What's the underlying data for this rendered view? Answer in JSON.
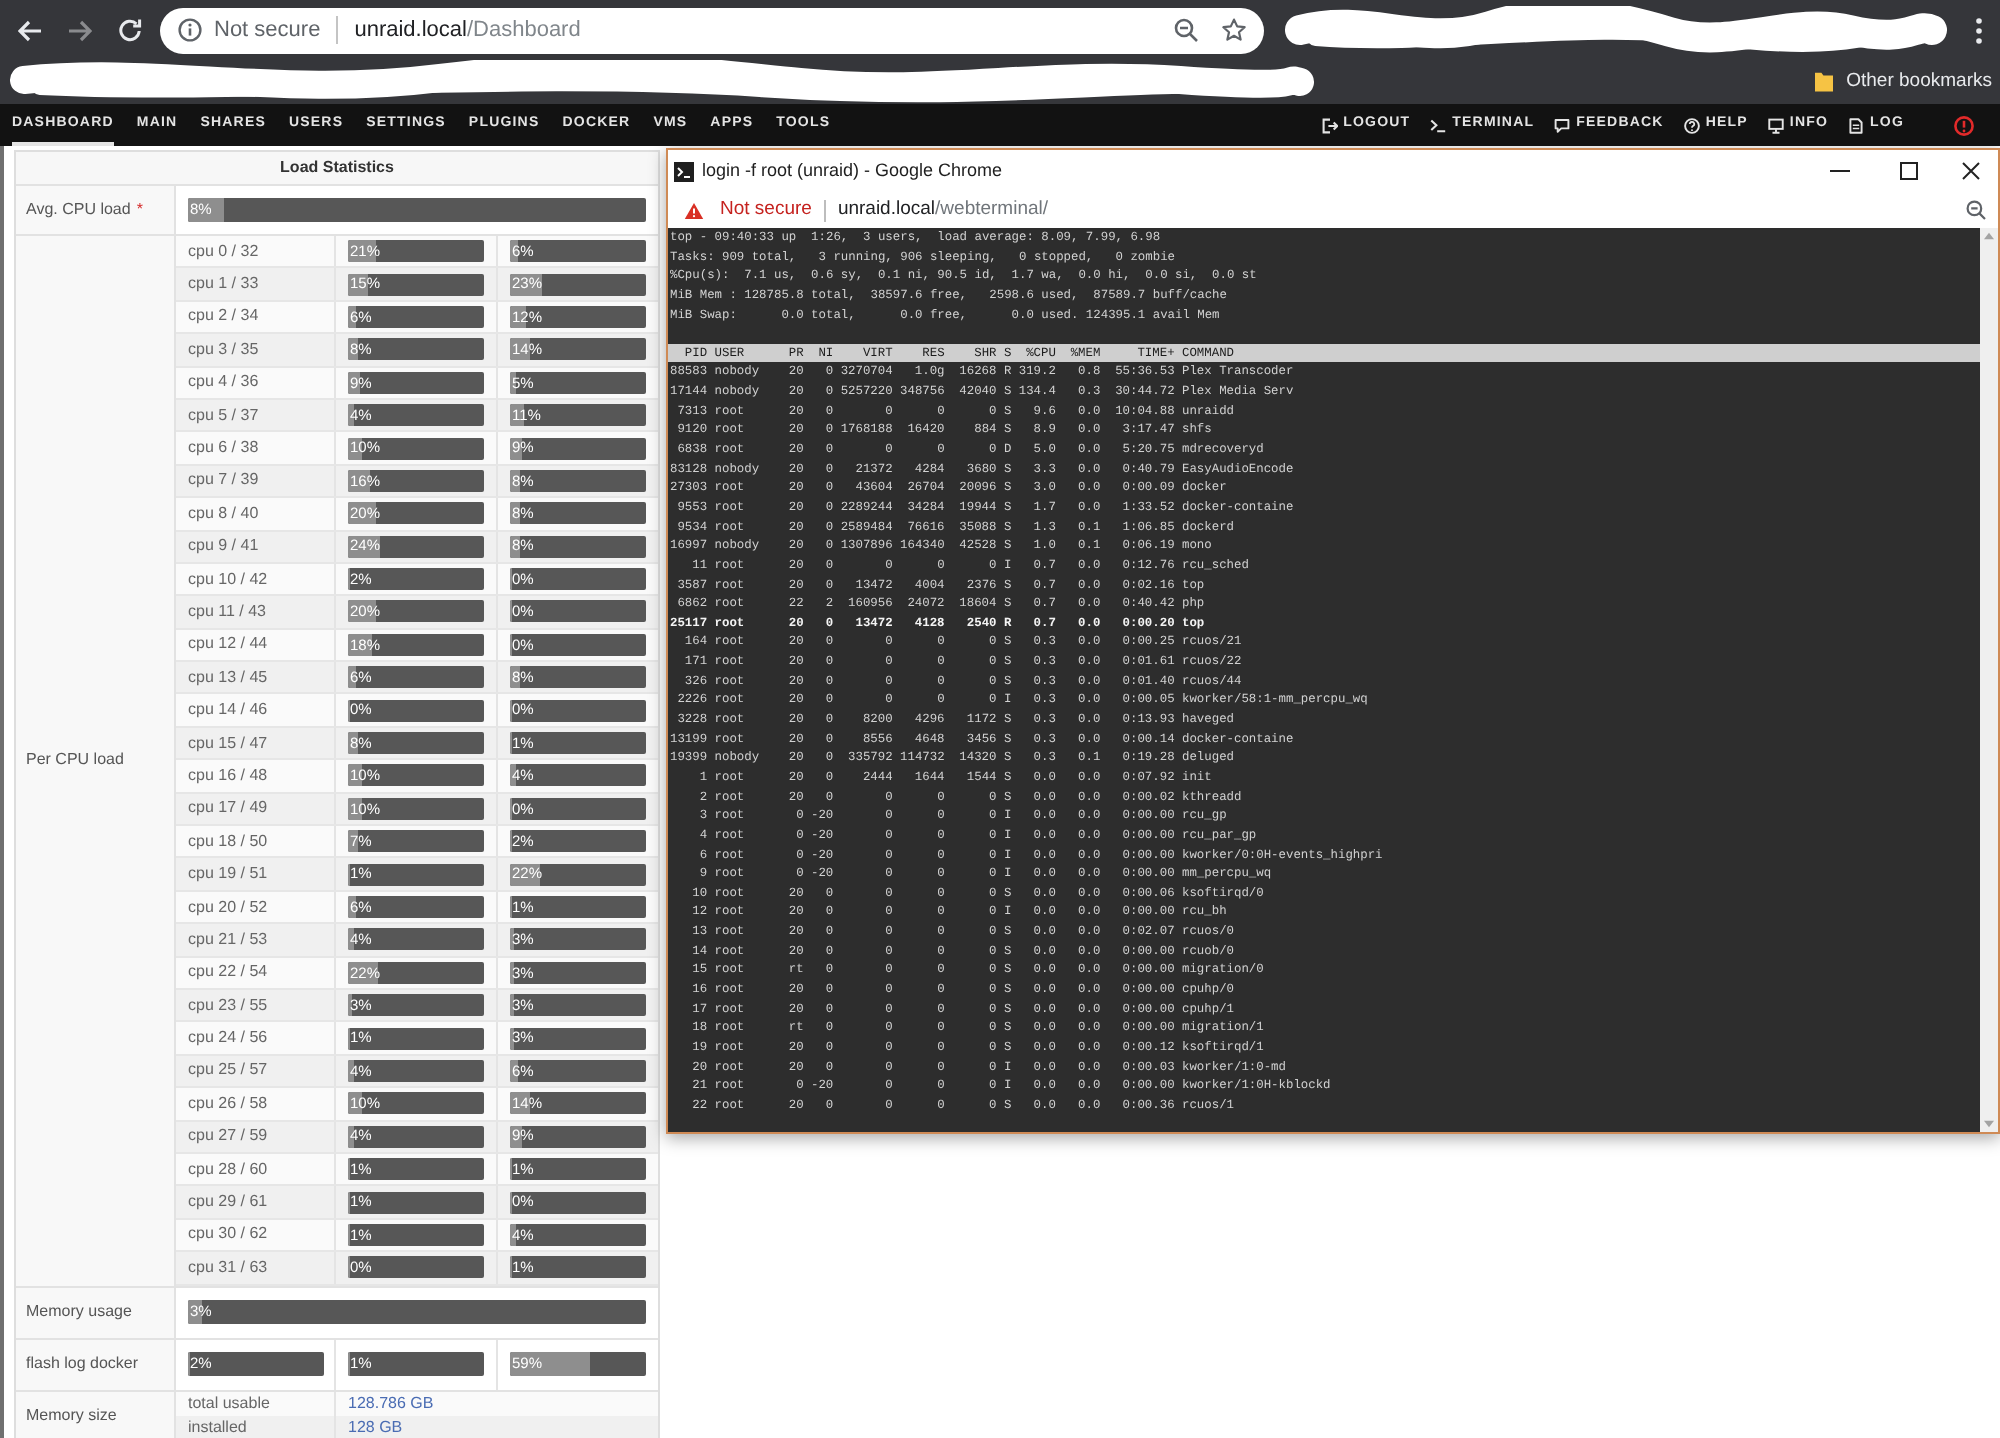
{
  "browser": {
    "address_bar": {
      "security": "Not secure",
      "host": "unraid.local",
      "path": "/Dashboard"
    },
    "bookmarks_bar": {
      "items": [
        {
          "label": "Other bookmarks"
        }
      ]
    }
  },
  "nav": {
    "items": [
      {
        "label": "DASHBOARD",
        "selected": true
      },
      {
        "label": "MAIN",
        "selected": false
      },
      {
        "label": "SHARES",
        "selected": false
      },
      {
        "label": "USERS",
        "selected": false
      },
      {
        "label": "SETTINGS",
        "selected": false
      },
      {
        "label": "PLUGINS",
        "selected": false
      },
      {
        "label": "DOCKER",
        "selected": false
      },
      {
        "label": "VMS",
        "selected": false
      },
      {
        "label": "APPS",
        "selected": false
      },
      {
        "label": "TOOLS",
        "selected": false
      }
    ],
    "actions": [
      {
        "label": "LOGOUT"
      },
      {
        "label": "TERMINAL"
      },
      {
        "label": "FEEDBACK"
      },
      {
        "label": "HELP"
      },
      {
        "label": "INFO"
      },
      {
        "label": "LOG"
      }
    ]
  },
  "load_statistics": {
    "title": "Load Statistics",
    "avg_cpu_load": {
      "label": "Avg. CPU load",
      "marker": "*",
      "reading": "8%",
      "level": 0.08
    },
    "per_cpu_load": {
      "label": "Per CPU load",
      "rows": [
        {
          "name": "cpu 0 / 32",
          "cores": [
            {
              "reading": "21%",
              "level": 0.21
            },
            {
              "reading": "6%",
              "level": 0.06
            }
          ]
        },
        {
          "name": "cpu 1 / 33",
          "cores": [
            {
              "reading": "15%",
              "level": 0.15
            },
            {
              "reading": "23%",
              "level": 0.23
            }
          ]
        },
        {
          "name": "cpu 2 / 34",
          "cores": [
            {
              "reading": "6%",
              "level": 0.06
            },
            {
              "reading": "12%",
              "level": 0.12
            }
          ]
        },
        {
          "name": "cpu 3 / 35",
          "cores": [
            {
              "reading": "8%",
              "level": 0.08
            },
            {
              "reading": "14%",
              "level": 0.14
            }
          ]
        },
        {
          "name": "cpu 4 / 36",
          "cores": [
            {
              "reading": "9%",
              "level": 0.09
            },
            {
              "reading": "5%",
              "level": 0.05
            }
          ]
        },
        {
          "name": "cpu 5 / 37",
          "cores": [
            {
              "reading": "4%",
              "level": 0.04
            },
            {
              "reading": "11%",
              "level": 0.11
            }
          ]
        },
        {
          "name": "cpu 6 / 38",
          "cores": [
            {
              "reading": "10%",
              "level": 0.1
            },
            {
              "reading": "9%",
              "level": 0.09
            }
          ]
        },
        {
          "name": "cpu 7 / 39",
          "cores": [
            {
              "reading": "16%",
              "level": 0.16
            },
            {
              "reading": "8%",
              "level": 0.08
            }
          ]
        },
        {
          "name": "cpu 8 / 40",
          "cores": [
            {
              "reading": "20%",
              "level": 0.2
            },
            {
              "reading": "8%",
              "level": 0.08
            }
          ]
        },
        {
          "name": "cpu 9 / 41",
          "cores": [
            {
              "reading": "24%",
              "level": 0.24
            },
            {
              "reading": "8%",
              "level": 0.08
            }
          ]
        },
        {
          "name": "cpu 10 / 42",
          "cores": [
            {
              "reading": "2%",
              "level": 0.02
            },
            {
              "reading": "0%",
              "level": 0
            }
          ]
        },
        {
          "name": "cpu 11 / 43",
          "cores": [
            {
              "reading": "20%",
              "level": 0.2
            },
            {
              "reading": "0%",
              "level": 0
            }
          ]
        },
        {
          "name": "cpu 12 / 44",
          "cores": [
            {
              "reading": "18%",
              "level": 0.18
            },
            {
              "reading": "0%",
              "level": 0
            }
          ]
        },
        {
          "name": "cpu 13 / 45",
          "cores": [
            {
              "reading": "6%",
              "level": 0.06
            },
            {
              "reading": "8%",
              "level": 0.08
            }
          ]
        },
        {
          "name": "cpu 14 / 46",
          "cores": [
            {
              "reading": "0%",
              "level": 0
            },
            {
              "reading": "0%",
              "level": 0
            }
          ]
        },
        {
          "name": "cpu 15 / 47",
          "cores": [
            {
              "reading": "8%",
              "level": 0.08
            },
            {
              "reading": "1%",
              "level": 0.01
            }
          ]
        },
        {
          "name": "cpu 16 / 48",
          "cores": [
            {
              "reading": "10%",
              "level": 0.1
            },
            {
              "reading": "4%",
              "level": 0.04
            }
          ]
        },
        {
          "name": "cpu 17 / 49",
          "cores": [
            {
              "reading": "10%",
              "level": 0.1
            },
            {
              "reading": "0%",
              "level": 0
            }
          ]
        },
        {
          "name": "cpu 18 / 50",
          "cores": [
            {
              "reading": "7%",
              "level": 0.07
            },
            {
              "reading": "2%",
              "level": 0.02
            }
          ]
        },
        {
          "name": "cpu 19 / 51",
          "cores": [
            {
              "reading": "1%",
              "level": 0.01
            },
            {
              "reading": "22%",
              "level": 0.22
            }
          ]
        },
        {
          "name": "cpu 20 / 52",
          "cores": [
            {
              "reading": "6%",
              "level": 0.06
            },
            {
              "reading": "1%",
              "level": 0.01
            }
          ]
        },
        {
          "name": "cpu 21 / 53",
          "cores": [
            {
              "reading": "4%",
              "level": 0.04
            },
            {
              "reading": "3%",
              "level": 0.03
            }
          ]
        },
        {
          "name": "cpu 22 / 54",
          "cores": [
            {
              "reading": "22%",
              "level": 0.22
            },
            {
              "reading": "3%",
              "level": 0.03
            }
          ]
        },
        {
          "name": "cpu 23 / 55",
          "cores": [
            {
              "reading": "3%",
              "level": 0.03
            },
            {
              "reading": "3%",
              "level": 0.03
            }
          ]
        },
        {
          "name": "cpu 24 / 56",
          "cores": [
            {
              "reading": "1%",
              "level": 0.01
            },
            {
              "reading": "3%",
              "level": 0.03
            }
          ]
        },
        {
          "name": "cpu 25 / 57",
          "cores": [
            {
              "reading": "4%",
              "level": 0.04
            },
            {
              "reading": "6%",
              "level": 0.06
            }
          ]
        },
        {
          "name": "cpu 26 / 58",
          "cores": [
            {
              "reading": "10%",
              "level": 0.1
            },
            {
              "reading": "14%",
              "level": 0.14
            }
          ]
        },
        {
          "name": "cpu 27 / 59",
          "cores": [
            {
              "reading": "4%",
              "level": 0.04
            },
            {
              "reading": "9%",
              "level": 0.09
            }
          ]
        },
        {
          "name": "cpu 28 / 60",
          "cores": [
            {
              "reading": "1%",
              "level": 0.01
            },
            {
              "reading": "1%",
              "level": 0.01
            }
          ]
        },
        {
          "name": "cpu 29 / 61",
          "cores": [
            {
              "reading": "1%",
              "level": 0.01
            },
            {
              "reading": "0%",
              "level": 0
            }
          ]
        },
        {
          "name": "cpu 30 / 62",
          "cores": [
            {
              "reading": "1%",
              "level": 0.01
            },
            {
              "reading": "4%",
              "level": 0.04
            }
          ]
        },
        {
          "name": "cpu 31 / 63",
          "cores": [
            {
              "reading": "0%",
              "level": 0
            },
            {
              "reading": "1%",
              "level": 0.01
            }
          ]
        }
      ]
    },
    "memory_usage": {
      "label": "Memory usage",
      "reading": "3%",
      "level": 0.03
    },
    "flash_log_docker": {
      "label": "flash log docker",
      "meters": [
        {
          "reading": "2%",
          "level": 0.02
        },
        {
          "reading": "1%",
          "level": 0.01
        },
        {
          "reading": "59%",
          "level": 0.59
        }
      ]
    },
    "memory_size": {
      "label": "Memory size",
      "rows": [
        {
          "label": "total usable",
          "value": "128.786 GB"
        },
        {
          "label": "installed",
          "value": "128 GB"
        }
      ]
    }
  },
  "terminal_window": {
    "title": "login -f root (unraid) - Google Chrome",
    "address_bar": {
      "security": "Not secure",
      "host": "unraid.local",
      "path": "/webterminal/"
    },
    "summary_lines": [
      "top - 09:40:33 up  1:26,  3 users,  load average: 8.09, 7.99, 6.98",
      "Tasks: 909 total,   3 running, 906 sleeping,   0 stopped,   0 zombie",
      "%Cpu(s):  7.1 us,  0.6 sy,  0.1 ni, 90.5 id,  1.7 wa,  0.0 hi,  0.0 si,  0.0 st",
      "MiB Mem : 128785.8 total,  38597.6 free,   2598.6 used,  87589.7 buff/cache",
      "MiB Swap:      0.0 total,      0.0 free,      0.0 used. 124395.1 avail Mem"
    ],
    "process_table": {
      "columns": [
        "PID",
        "USER",
        "PR",
        "NI",
        "VIRT",
        "RES",
        "SHR",
        "S",
        "%CPU",
        "%MEM",
        "TIME+",
        "COMMAND"
      ],
      "rows": [
        {
          "cells": [
            "88583",
            "nobody",
            "20",
            "0",
            "3270704",
            "1.0g",
            "16268",
            "R",
            "319.2",
            "0.8",
            "55:36.53",
            "Plex Transcoder"
          ],
          "highlighted": false
        },
        {
          "cells": [
            "17144",
            "nobody",
            "20",
            "0",
            "5257220",
            "348756",
            "42040",
            "S",
            "134.4",
            "0.3",
            "30:44.72",
            "Plex Media Serv"
          ],
          "highlighted": false
        },
        {
          "cells": [
            "7313",
            "root",
            "20",
            "0",
            "0",
            "0",
            "0",
            "S",
            "9.6",
            "0.0",
            "10:04.88",
            "unraidd"
          ],
          "highlighted": false
        },
        {
          "cells": [
            "9120",
            "root",
            "20",
            "0",
            "1768188",
            "16420",
            "884",
            "S",
            "8.9",
            "0.0",
            "3:17.47",
            "shfs"
          ],
          "highlighted": false
        },
        {
          "cells": [
            "6838",
            "root",
            "20",
            "0",
            "0",
            "0",
            "0",
            "D",
            "5.0",
            "0.0",
            "5:20.75",
            "mdrecoveryd"
          ],
          "highlighted": false
        },
        {
          "cells": [
            "83128",
            "nobody",
            "20",
            "0",
            "21372",
            "4284",
            "3680",
            "S",
            "3.3",
            "0.0",
            "0:40.79",
            "EasyAudioEncode"
          ],
          "highlighted": false
        },
        {
          "cells": [
            "27303",
            "root",
            "20",
            "0",
            "43604",
            "26704",
            "20096",
            "S",
            "3.0",
            "0.0",
            "0:00.09",
            "docker"
          ],
          "highlighted": false
        },
        {
          "cells": [
            "9553",
            "root",
            "20",
            "0",
            "2289244",
            "34284",
            "19944",
            "S",
            "1.7",
            "0.0",
            "1:33.52",
            "docker-containe"
          ],
          "highlighted": false
        },
        {
          "cells": [
            "9534",
            "root",
            "20",
            "0",
            "2589484",
            "76616",
            "35088",
            "S",
            "1.3",
            "0.1",
            "1:06.85",
            "dockerd"
          ],
          "highlighted": false
        },
        {
          "cells": [
            "16997",
            "nobody",
            "20",
            "0",
            "1307896",
            "164340",
            "42528",
            "S",
            "1.0",
            "0.1",
            "0:06.19",
            "mono"
          ],
          "highlighted": false
        },
        {
          "cells": [
            "11",
            "root",
            "20",
            "0",
            "0",
            "0",
            "0",
            "I",
            "0.7",
            "0.0",
            "0:12.76",
            "rcu_sched"
          ],
          "highlighted": false
        },
        {
          "cells": [
            "3587",
            "root",
            "20",
            "0",
            "13472",
            "4004",
            "2376",
            "S",
            "0.7",
            "0.0",
            "0:02.16",
            "top"
          ],
          "highlighted": false
        },
        {
          "cells": [
            "6862",
            "root",
            "22",
            "2",
            "160956",
            "24072",
            "18604",
            "S",
            "0.7",
            "0.0",
            "0:40.42",
            "php"
          ],
          "highlighted": false
        },
        {
          "cells": [
            "25117",
            "root",
            "20",
            "0",
            "13472",
            "4128",
            "2540",
            "R",
            "0.7",
            "0.0",
            "0:00.20",
            "top"
          ],
          "highlighted": true
        },
        {
          "cells": [
            "164",
            "root",
            "20",
            "0",
            "0",
            "0",
            "0",
            "S",
            "0.3",
            "0.0",
            "0:00.25",
            "rcuos/21"
          ],
          "highlighted": false
        },
        {
          "cells": [
            "171",
            "root",
            "20",
            "0",
            "0",
            "0",
            "0",
            "S",
            "0.3",
            "0.0",
            "0:01.61",
            "rcuos/22"
          ],
          "highlighted": false
        },
        {
          "cells": [
            "326",
            "root",
            "20",
            "0",
            "0",
            "0",
            "0",
            "S",
            "0.3",
            "0.0",
            "0:01.40",
            "rcuos/44"
          ],
          "highlighted": false
        },
        {
          "cells": [
            "2226",
            "root",
            "20",
            "0",
            "0",
            "0",
            "0",
            "I",
            "0.3",
            "0.0",
            "0:00.05",
            "kworker/58:1-mm_percpu_wq"
          ],
          "highlighted": false
        },
        {
          "cells": [
            "3228",
            "root",
            "20",
            "0",
            "8200",
            "4296",
            "1172",
            "S",
            "0.3",
            "0.0",
            "0:13.93",
            "haveged"
          ],
          "highlighted": false
        },
        {
          "cells": [
            "13199",
            "root",
            "20",
            "0",
            "8556",
            "4648",
            "3456",
            "S",
            "0.3",
            "0.0",
            "0:00.14",
            "docker-containe"
          ],
          "highlighted": false
        },
        {
          "cells": [
            "19399",
            "nobody",
            "20",
            "0",
            "335792",
            "114732",
            "14320",
            "S",
            "0.3",
            "0.1",
            "0:19.28",
            "deluged"
          ],
          "highlighted": false
        },
        {
          "cells": [
            "1",
            "root",
            "20",
            "0",
            "2444",
            "1644",
            "1544",
            "S",
            "0.0",
            "0.0",
            "0:07.92",
            "init"
          ],
          "highlighted": false
        },
        {
          "cells": [
            "2",
            "root",
            "20",
            "0",
            "0",
            "0",
            "0",
            "S",
            "0.0",
            "0.0",
            "0:00.02",
            "kthreadd"
          ],
          "highlighted": false
        },
        {
          "cells": [
            "3",
            "root",
            "0",
            "-20",
            "0",
            "0",
            "0",
            "I",
            "0.0",
            "0.0",
            "0:00.00",
            "rcu_gp"
          ],
          "highlighted": false
        },
        {
          "cells": [
            "4",
            "root",
            "0",
            "-20",
            "0",
            "0",
            "0",
            "I",
            "0.0",
            "0.0",
            "0:00.00",
            "rcu_par_gp"
          ],
          "highlighted": false
        },
        {
          "cells": [
            "6",
            "root",
            "0",
            "-20",
            "0",
            "0",
            "0",
            "I",
            "0.0",
            "0.0",
            "0:00.00",
            "kworker/0:0H-events_highpri"
          ],
          "highlighted": false
        },
        {
          "cells": [
            "9",
            "root",
            "0",
            "-20",
            "0",
            "0",
            "0",
            "I",
            "0.0",
            "0.0",
            "0:00.00",
            "mm_percpu_wq"
          ],
          "highlighted": false
        },
        {
          "cells": [
            "10",
            "root",
            "20",
            "0",
            "0",
            "0",
            "0",
            "S",
            "0.0",
            "0.0",
            "0:00.06",
            "ksoftirqd/0"
          ],
          "highlighted": false
        },
        {
          "cells": [
            "12",
            "root",
            "20",
            "0",
            "0",
            "0",
            "0",
            "I",
            "0.0",
            "0.0",
            "0:00.00",
            "rcu_bh"
          ],
          "highlighted": false
        },
        {
          "cells": [
            "13",
            "root",
            "20",
            "0",
            "0",
            "0",
            "0",
            "S",
            "0.0",
            "0.0",
            "0:02.07",
            "rcuos/0"
          ],
          "highlighted": false
        },
        {
          "cells": [
            "14",
            "root",
            "20",
            "0",
            "0",
            "0",
            "0",
            "S",
            "0.0",
            "0.0",
            "0:00.00",
            "rcuob/0"
          ],
          "highlighted": false
        },
        {
          "cells": [
            "15",
            "root",
            "rt",
            "0",
            "0",
            "0",
            "0",
            "S",
            "0.0",
            "0.0",
            "0:00.00",
            "migration/0"
          ],
          "highlighted": false
        },
        {
          "cells": [
            "16",
            "root",
            "20",
            "0",
            "0",
            "0",
            "0",
            "S",
            "0.0",
            "0.0",
            "0:00.00",
            "cpuhp/0"
          ],
          "highlighted": false
        },
        {
          "cells": [
            "17",
            "root",
            "20",
            "0",
            "0",
            "0",
            "0",
            "S",
            "0.0",
            "0.0",
            "0:00.00",
            "cpuhp/1"
          ],
          "highlighted": false
        },
        {
          "cells": [
            "18",
            "root",
            "rt",
            "0",
            "0",
            "0",
            "0",
            "S",
            "0.0",
            "0.0",
            "0:00.00",
            "migration/1"
          ],
          "highlighted": false
        },
        {
          "cells": [
            "19",
            "root",
            "20",
            "0",
            "0",
            "0",
            "0",
            "S",
            "0.0",
            "0.0",
            "0:00.12",
            "ksoftirqd/1"
          ],
          "highlighted": false
        },
        {
          "cells": [
            "20",
            "root",
            "20",
            "0",
            "0",
            "0",
            "0",
            "I",
            "0.0",
            "0.0",
            "0:00.03",
            "kworker/1:0-md"
          ],
          "highlighted": false
        },
        {
          "cells": [
            "21",
            "root",
            "0",
            "-20",
            "0",
            "0",
            "0",
            "I",
            "0.0",
            "0.0",
            "0:00.00",
            "kworker/1:0H-kblockd"
          ],
          "highlighted": false
        },
        {
          "cells": [
            "22",
            "root",
            "20",
            "0",
            "0",
            "0",
            "0",
            "S",
            "0.0",
            "0.0",
            "0:00.36",
            "rcuos/1"
          ],
          "highlighted": false
        }
      ]
    }
  }
}
